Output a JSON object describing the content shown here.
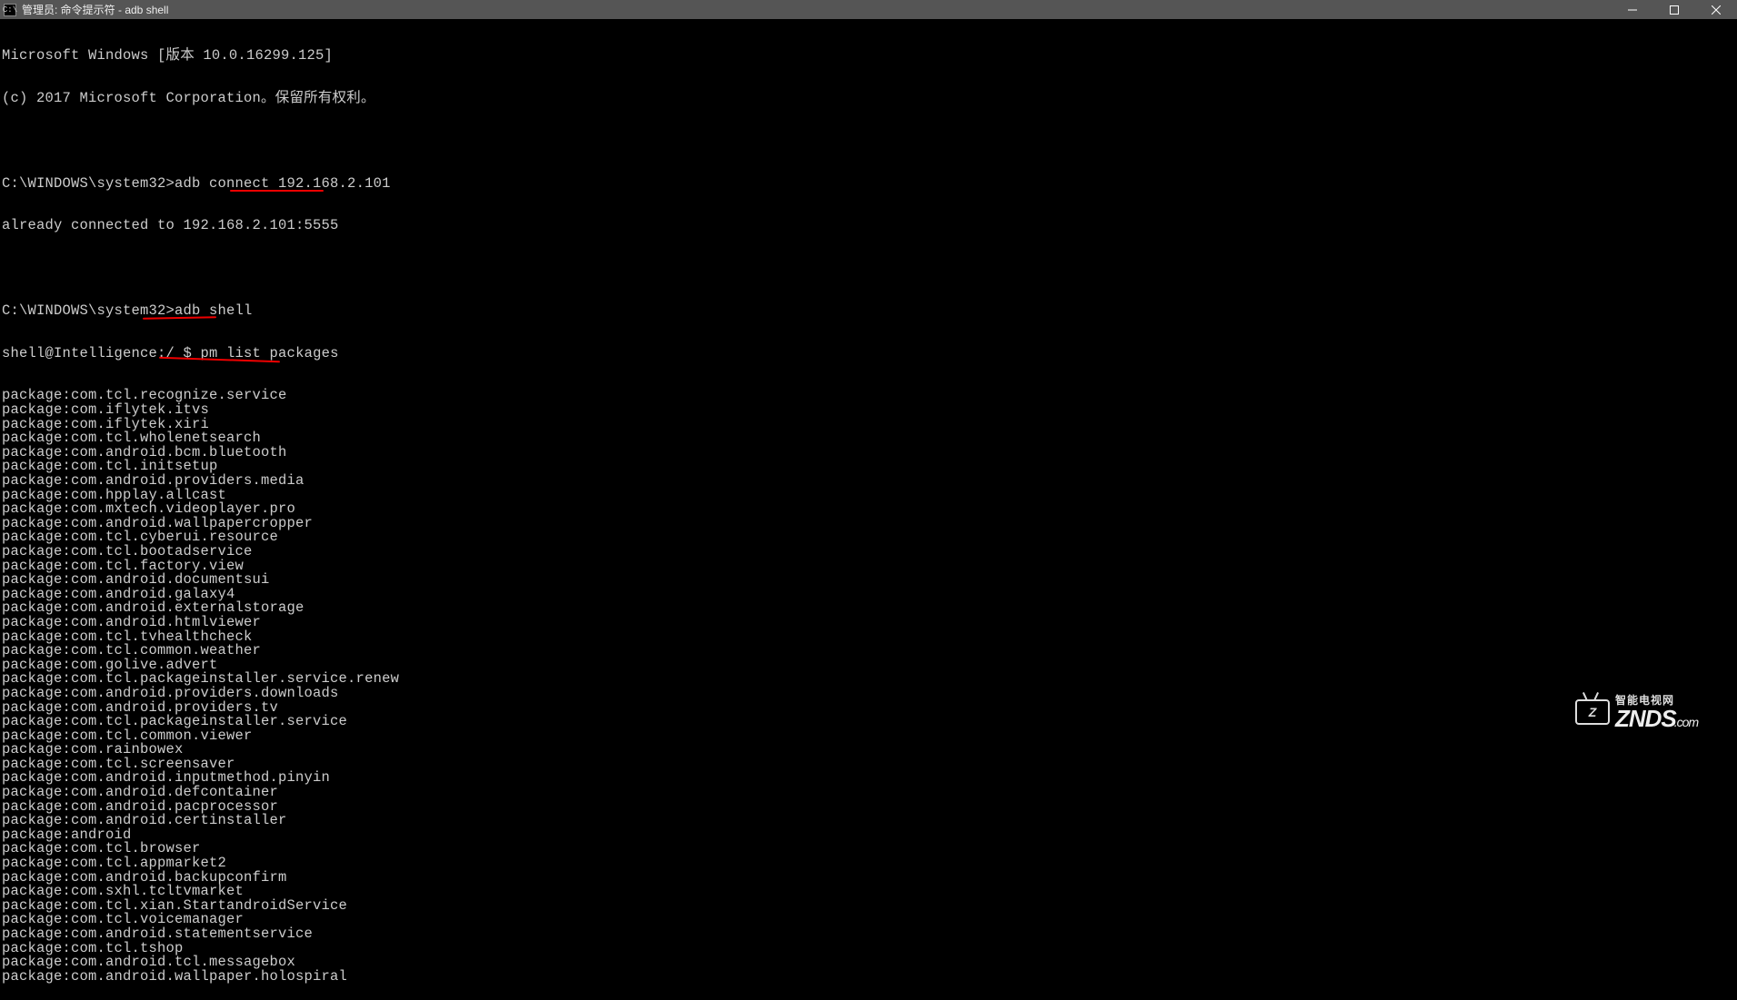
{
  "window": {
    "icon_text": "C:\\",
    "title": "管理员: 命令提示符 - adb  shell"
  },
  "header": {
    "line1": "Microsoft Windows [版本 10.0.16299.125]",
    "line2": "(c) 2017 Microsoft Corporation。保留所有权利。"
  },
  "block1": {
    "prompt": "C:\\WINDOWS\\system32>",
    "cmd": "adb connect 192.168.2.101",
    "result": "already connected to 192.168.2.101:5555"
  },
  "block2": {
    "prompt": "C:\\WINDOWS\\system32>",
    "cmd": "adb shell",
    "shell_prompt": "shell@Intelligence:/ $ ",
    "shell_cmd": "pm list packages"
  },
  "packages": [
    "package:com.tcl.recognize.service",
    "package:com.iflytek.itvs",
    "package:com.iflytek.xiri",
    "package:com.tcl.wholenetsearch",
    "package:com.android.bcm.bluetooth",
    "package:com.tcl.initsetup",
    "package:com.android.providers.media",
    "package:com.hpplay.allcast",
    "package:com.mxtech.videoplayer.pro",
    "package:com.android.wallpapercropper",
    "package:com.tcl.cyberui.resource",
    "package:com.tcl.bootadservice",
    "package:com.tcl.factory.view",
    "package:com.android.documentsui",
    "package:com.android.galaxy4",
    "package:com.android.externalstorage",
    "package:com.android.htmlviewer",
    "package:com.tcl.tvhealthcheck",
    "package:com.tcl.common.weather",
    "package:com.golive.advert",
    "package:com.tcl.packageinstaller.service.renew",
    "package:com.android.providers.downloads",
    "package:com.android.providers.tv",
    "package:com.tcl.packageinstaller.service",
    "package:com.tcl.common.viewer",
    "package:com.rainbowex",
    "package:com.tcl.screensaver",
    "package:com.android.inputmethod.pinyin",
    "package:com.android.defcontainer",
    "package:com.android.pacprocessor",
    "package:com.android.certinstaller",
    "package:android",
    "package:com.tcl.browser",
    "package:com.tcl.appmarket2",
    "package:com.android.backupconfirm",
    "package:com.sxhl.tcltvmarket",
    "package:com.tcl.xian.StartandroidService",
    "package:com.tcl.voicemanager",
    "package:com.android.statementservice",
    "package:com.tcl.tshop",
    "package:com.android.tcl.messagebox",
    "package:com.android.wallpaper.holospiral"
  ],
  "watermark": {
    "cn": "智能电视网",
    "brand": "ZNDS",
    "suffix": ".com",
    "tv_text": "Z"
  }
}
